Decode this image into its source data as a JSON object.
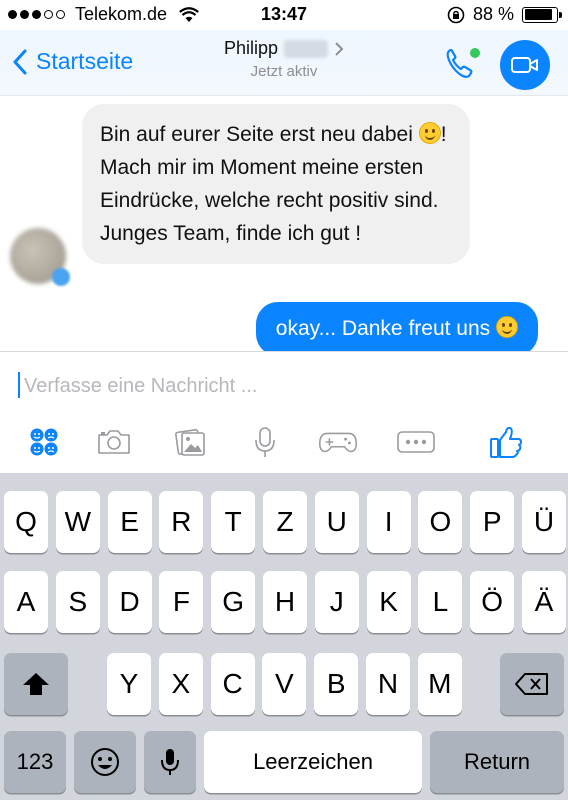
{
  "status_bar": {
    "carrier": "Telekom.de",
    "time": "13:47",
    "battery": "88 %",
    "battery_level": 0.88
  },
  "header": {
    "back_label": "Startseite",
    "contact_name": "Philipp",
    "contact_status": "Jetzt aktiv",
    "accent_color": "#0a84ff",
    "online_dot_color": "#34c759"
  },
  "messages": [
    {
      "direction": "incoming",
      "text_before_emoji": "Bin auf eurer Seite erst neu dabei ",
      "text_after_emoji": "! Mach mir im Moment meine ersten Eindrücke, welche recht positiv sind. Junges Team, finde ich gut !"
    },
    {
      "direction": "outgoing",
      "text_before_emoji": "okay... Danke freut uns ",
      "text_after_emoji": ""
    }
  ],
  "compose": {
    "placeholder": "Verfasse eine Nachricht ...",
    "tools": [
      "stickers-icon",
      "camera-icon",
      "gallery-icon",
      "microphone-icon",
      "gamepad-icon",
      "more-icon",
      "thumbs-up-icon"
    ]
  },
  "keyboard": {
    "row1": [
      "Q",
      "W",
      "E",
      "R",
      "T",
      "Z",
      "U",
      "I",
      "O",
      "P",
      "Ü"
    ],
    "row2": [
      "A",
      "S",
      "D",
      "F",
      "G",
      "H",
      "J",
      "K",
      "L",
      "Ö",
      "Ä"
    ],
    "row3": [
      "Y",
      "X",
      "C",
      "V",
      "B",
      "N",
      "M"
    ],
    "numbers_label": "123",
    "space_label": "Leerzeichen",
    "return_label": "Return"
  }
}
